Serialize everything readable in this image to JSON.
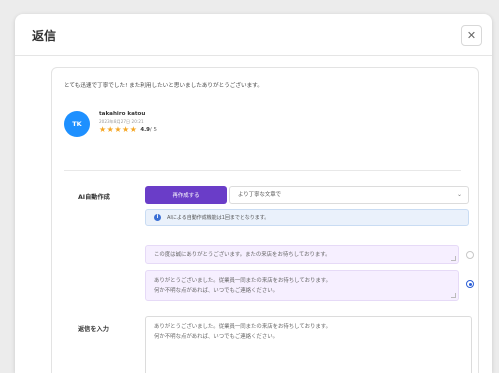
{
  "modal": {
    "title": "返信",
    "close_glyph": "✕"
  },
  "review": {
    "text": "とても迅速で丁寧でした! また利用したいと思いましたありがとうございます。",
    "avatar_initials": "TK",
    "reviewer_name": "takahiro katou",
    "date": "2023年8月27日 20:21",
    "stars": [
      "★",
      "★",
      "★",
      "★",
      "★"
    ],
    "rating_value": "4.9",
    "rating_max": " / 5"
  },
  "ai": {
    "label": "AI自動作成",
    "generate_button": "再作成する",
    "tone_selected": "より丁寧な文章で",
    "tone_chevron": "⌄",
    "info_icon": "i",
    "info_text": "AIによる自動作成機能は1回までとなります。",
    "suggestions": [
      {
        "text": "この度は誠にありがとうございます。またの来店をお待ちしております。",
        "selected": false
      },
      {
        "text": "ありがとうございました。従業員一同またの来店をお待ちしております。\n何か不明な点があれば、いつでもご連絡ください。",
        "selected": true
      }
    ]
  },
  "reply": {
    "label": "返信を入力",
    "value": "ありがとうございました。従業員一同またの来店をお待ちしております。\n何か不明な点があれば、いつでもご連絡ください。"
  },
  "colors": {
    "accent_purple": "#6a3dc8",
    "avatar_blue": "#1e90ff",
    "star_gold": "#f5a623",
    "info_blue": "#3b6fd4",
    "suggestion_bg": "#f6efff"
  },
  "icons": {
    "close": "close-icon",
    "star": "star-icon",
    "info": "info-icon",
    "chevron": "chevron-down-icon"
  }
}
